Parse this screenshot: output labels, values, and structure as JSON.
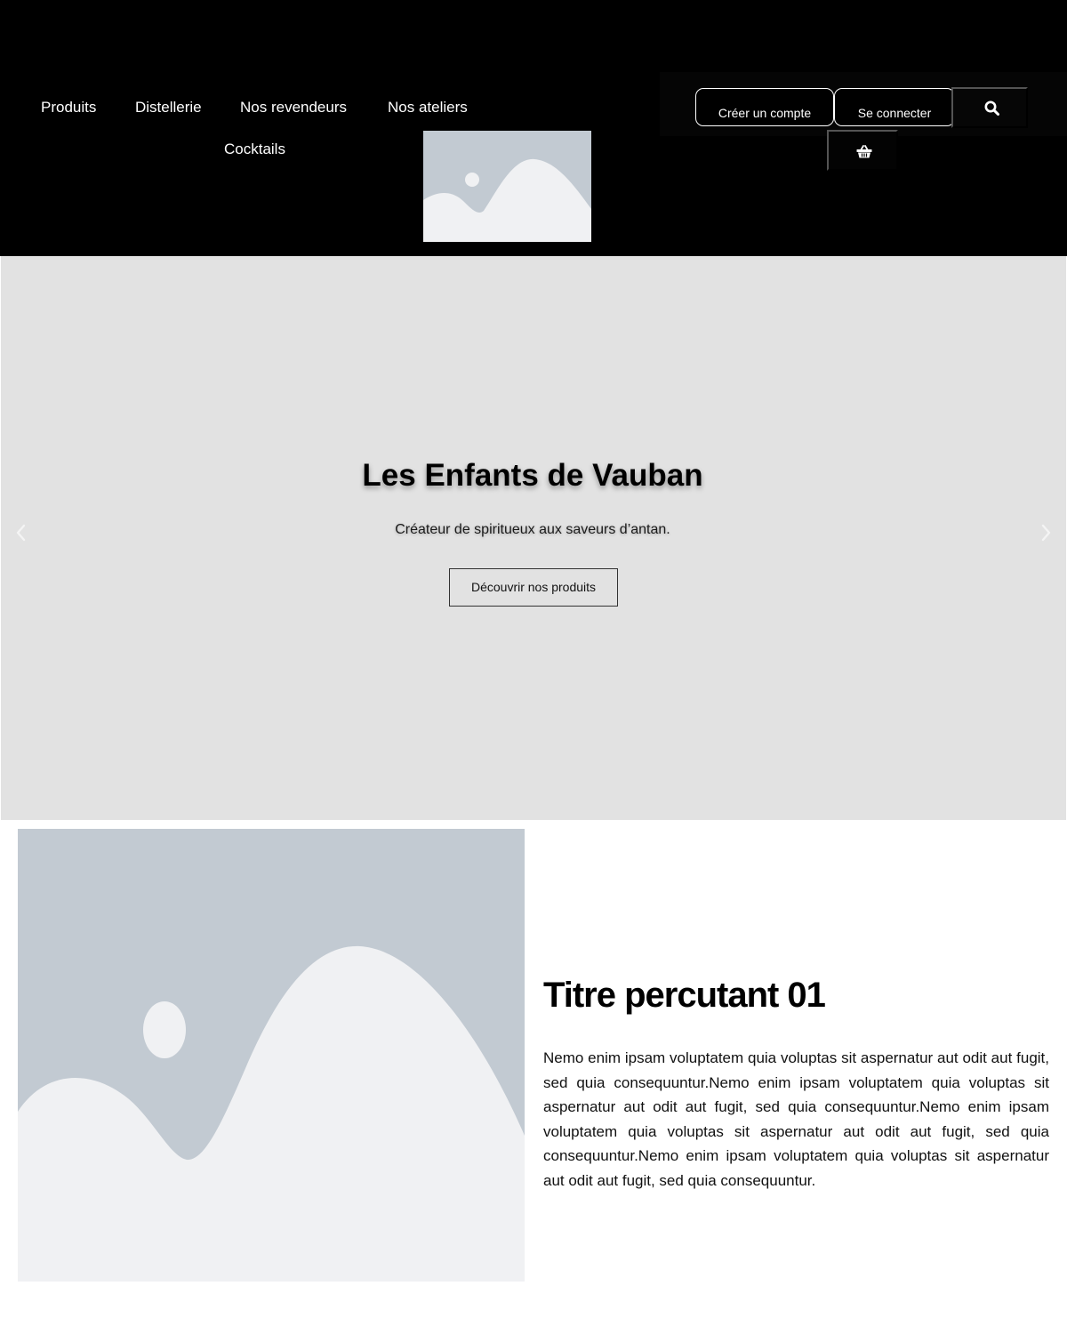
{
  "header": {
    "nav": {
      "items": [
        "Produits",
        "Distellerie",
        "Nos revendeurs",
        "Nos ateliers",
        "Cocktails"
      ]
    },
    "logo_icon": "image-placeholder-icon",
    "actions": {
      "create_account": "Créer un compte",
      "login": "Se connecter",
      "search_icon": "search-icon",
      "cart_icon": "basket-icon"
    }
  },
  "hero": {
    "title": "Les Enfants de Vauban",
    "subtitle": "Créateur de spiritueux aux saveurs d’antan.",
    "cta": "Découvrir nos produits",
    "prev_icon": "chevron-left-icon",
    "next_icon": "chevron-right-icon"
  },
  "feature": {
    "image_icon": "image-placeholder-icon",
    "title": "Titre percutant 01",
    "text": "Nemo enim ipsam voluptatem quia voluptas sit aspernatur aut odit aut fugit, sed quia consequuntur.Nemo enim ipsam voluptatem quia voluptas sit aspernatur aut odit aut fugit, sed quia consequuntur.Nemo enim ipsam voluptatem quia voluptas sit aspernatur aut odit aut fugit, sed quia consequuntur.Nemo enim ipsam voluptatem quia voluptas sit aspernatur aut odit aut fugit, sed quia consequuntur."
  },
  "colors": {
    "header_bg": "#000000",
    "hero_bg": "#e2e2e2",
    "placeholder_bg": "#c2cad2",
    "placeholder_fg": "#f0f1f3"
  }
}
